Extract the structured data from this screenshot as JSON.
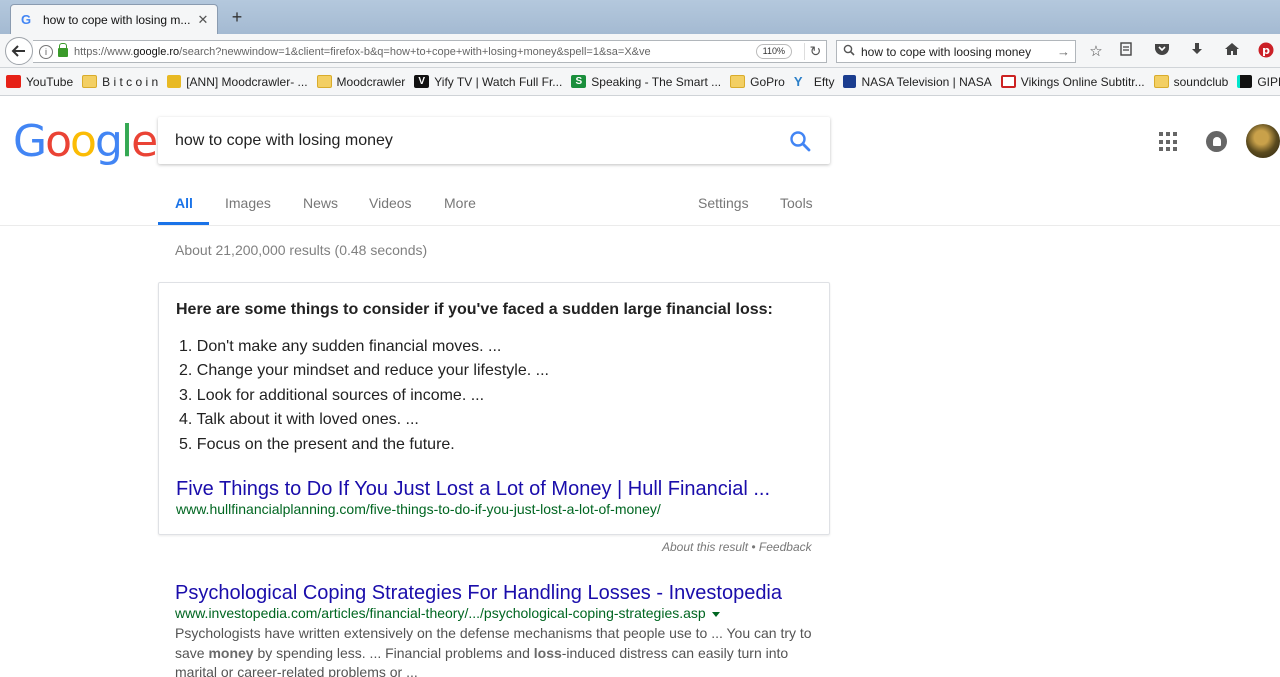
{
  "browser": {
    "tab_title": "how to cope with losing m...",
    "tab_close": "✕",
    "new_tab": "+",
    "url_prefix": "https://www.",
    "url_domain": "google.ro",
    "url_rest": "/search?newwindow=1&client=firefox-b&q=how+to+cope+with+losing+money&spell=1&sa=X&ve",
    "zoom": "110%",
    "search_value": "how to cope with loosing money",
    "bookmarks": [
      {
        "icon": "youtube-icon",
        "cls": "ic-yt",
        "label": "YouTube"
      },
      {
        "icon": "folder-icon",
        "cls": "ic-folder",
        "label": "B i t c o i n"
      },
      {
        "icon": "coin-icon",
        "cls": "ic-coin",
        "label": "[ANN] Moodcrawler- ..."
      },
      {
        "icon": "folder-icon",
        "cls": "ic-folder",
        "label": "Moodcrawler"
      },
      {
        "icon": "yify-icon",
        "cls": "ic-v",
        "glyph": "V",
        "label": "Yify TV | Watch Full Fr..."
      },
      {
        "icon": "speaking-icon",
        "cls": "ic-s",
        "glyph": "S",
        "label": "Speaking - The Smart ..."
      },
      {
        "icon": "folder-icon",
        "cls": "ic-folder",
        "label": "GoPro"
      },
      {
        "icon": "efty-icon",
        "cls": "ic-y",
        "glyph": "Y",
        "label": "Efty"
      },
      {
        "icon": "nasa-icon",
        "cls": "ic-nasa",
        "label": "NASA Television | NASA"
      },
      {
        "icon": "tv-icon",
        "cls": "ic-tv",
        "label": "Vikings Online Subtitr..."
      },
      {
        "icon": "folder-icon",
        "cls": "ic-folder",
        "label": "soundclub"
      },
      {
        "icon": "giphy-icon",
        "cls": "ic-giphy",
        "label": "GIPHY |"
      }
    ]
  },
  "google": {
    "logo_letters": [
      {
        "ch": "G",
        "color": "#4285f4"
      },
      {
        "ch": "o",
        "color": "#ea4335"
      },
      {
        "ch": "o",
        "color": "#fbbc05"
      },
      {
        "ch": "g",
        "color": "#4285f4"
      },
      {
        "ch": "l",
        "color": "#34a853"
      },
      {
        "ch": "e",
        "color": "#ea4335"
      }
    ],
    "query": "how to cope with losing money",
    "tabs": {
      "all": "All",
      "images": "Images",
      "news": "News",
      "videos": "Videos",
      "more": "More",
      "settings": "Settings",
      "tools": "Tools"
    },
    "accent_color": "#1a73e8",
    "stats": "About 21,200,000 results (0.48 seconds)",
    "snippet": {
      "heading": "Here are some things to consider if you've faced a sudden large financial loss:",
      "items": [
        "1. Don't make any sudden financial moves. ...",
        "2. Change your mindset and reduce your lifestyle. ...",
        "3. Look for additional sources of income. ...",
        "4. Talk about it with loved ones. ...",
        "5. Focus on the present and the future."
      ],
      "link_title": "Five Things to Do If You Just Lost a Lot of Money | Hull Financial ...",
      "cite": "www.hullfinancialplanning.com/five-things-to-do-if-you-just-lost-a-lot-of-money/",
      "about": "About this result",
      "separator": " • ",
      "feedback": "Feedback"
    },
    "results": [
      {
        "title": "Psychological Coping Strategies For Handling Losses - Investopedia",
        "cite": "www.investopedia.com/articles/financial-theory/.../psychological-coping-strategies.asp",
        "desc_parts": [
          {
            "t": "Psychologists have written extensively on the defense mechanisms that people use to ... You can try to save ",
            "b": false
          },
          {
            "t": "money",
            "b": true
          },
          {
            "t": " by spending less. ... Financial problems and ",
            "b": false
          },
          {
            "t": "loss",
            "b": true
          },
          {
            "t": "-induced distress can easily turn into marital or career-related problems or ...",
            "b": false
          }
        ]
      }
    ]
  }
}
